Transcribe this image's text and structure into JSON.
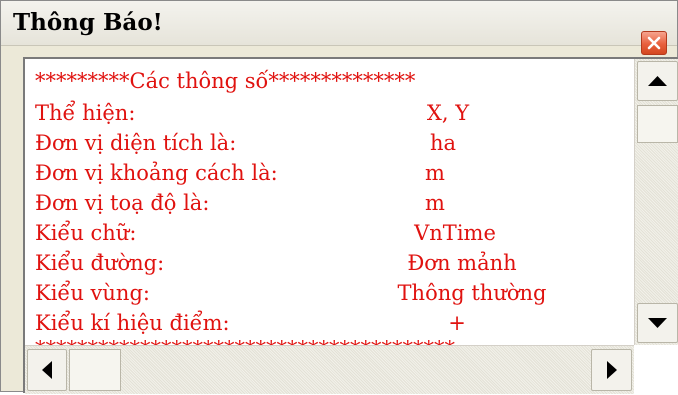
{
  "window": {
    "title": "Thông Báo!"
  },
  "message": {
    "header_line": "*********Các thông số**************",
    "rows": [
      {
        "label": "Thể hiện:",
        "value": "X, Y"
      },
      {
        "label": "Đơn vị diện tích là:",
        "value": "ha"
      },
      {
        "label": "Đơn vị khoảng cách là:",
        "value": "m"
      },
      {
        "label": "Đơn vị toạ độ là:",
        "value": "m"
      },
      {
        "label": "Kiểu chữ:",
        "value": "VnTime"
      },
      {
        "label": "Kiểu đường:",
        "value": "Đơn mảnh"
      },
      {
        "label": "Kiểu vùng:",
        "value": "Thông thường"
      },
      {
        "label": "Kiểu kí hiệu điểm:",
        "value": "+"
      }
    ],
    "footer_line": "****************************************"
  },
  "icons": {
    "close": "close-icon",
    "scroll_up": "arrow-up-icon",
    "scroll_down": "arrow-down-icon",
    "scroll_left": "arrow-left-icon",
    "scroll_right": "arrow-right-icon"
  },
  "colors": {
    "text": "#e0120f",
    "close_button": "#e8603d"
  }
}
